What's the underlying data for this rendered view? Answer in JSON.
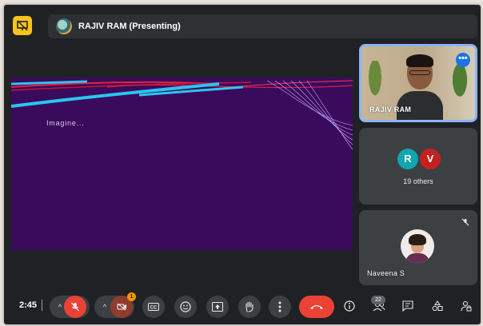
{
  "presenter_bar": {
    "title": "RAJIV RAM (Presenting)"
  },
  "stage": {
    "caption": "Imagine..."
  },
  "tiles": [
    {
      "name": "RAJIV RAM"
    },
    {
      "avatar_letters": [
        "R",
        "V"
      ],
      "others_label": "19 others"
    },
    {
      "name": "Naveena S"
    }
  ],
  "toolbar": {
    "clock": "2:45",
    "present_badge": "1",
    "people_count": "22"
  },
  "icons": {
    "present": "presentation-icon",
    "mic": "mic-off-icon",
    "camera": "camera-off-icon",
    "captions": "captions-icon",
    "reactions": "emoji-icon",
    "present_now": "present-screen-icon",
    "raise_hand": "hand-icon",
    "more": "more-vert-icon",
    "end_call": "phone-hangup-icon",
    "info": "info-icon",
    "people": "people-icon",
    "chat": "chat-icon",
    "activities": "shapes-icon",
    "host_controls": "lock-person-icon"
  },
  "colors": {
    "stage_bg": "#3a0b5c",
    "accent_blue": "#8ab4f8",
    "end_call_red": "#ea4335",
    "present_yellow": "#f9c31d"
  }
}
